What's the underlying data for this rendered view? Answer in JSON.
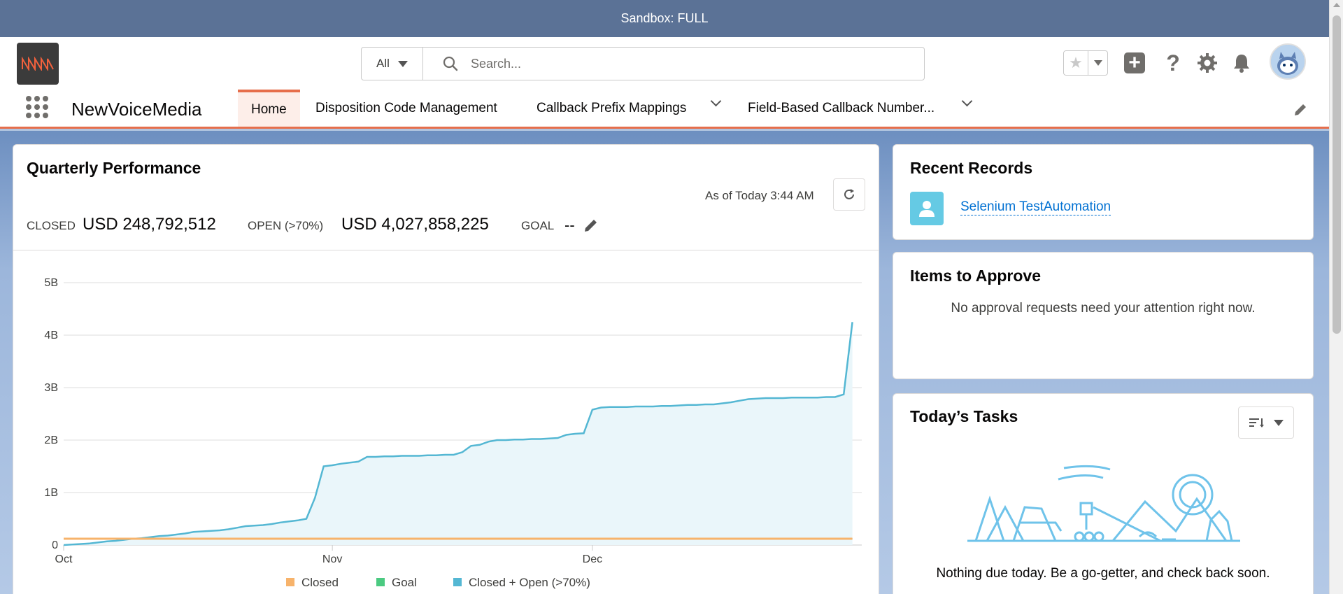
{
  "sandbox": {
    "label": "Sandbox: FULL"
  },
  "search": {
    "scope": "All",
    "placeholder": "Search..."
  },
  "nav": {
    "app_name": "NewVoiceMedia",
    "items": [
      {
        "label": "Home",
        "active": true
      },
      {
        "label": "Disposition Code Management"
      },
      {
        "label": "Callback Prefix Mappings"
      },
      {
        "label": "Field-Based Callback Number..."
      }
    ]
  },
  "performance": {
    "title": "Quarterly Performance",
    "as_of": "As of Today 3:44 AM",
    "closed_label": "CLOSED",
    "closed_value": "USD 248,792,512",
    "open_label": "OPEN (>70%)",
    "open_value": "USD 4,027,858,225",
    "goal_label": "GOAL",
    "goal_value": "--"
  },
  "chart_data": {
    "type": "line",
    "title": "",
    "xlabel": "",
    "ylabel": "",
    "y_ticks": [
      "0",
      "1B",
      "2B",
      "3B",
      "4B",
      "5B"
    ],
    "ylim": [
      0,
      5
    ],
    "x_ticks": [
      "Oct",
      "Nov",
      "Dec"
    ],
    "x_tick_days": [
      0,
      31,
      61
    ],
    "xlim": [
      0,
      92
    ],
    "legend": [
      "Closed",
      "Goal",
      "Closed + Open (>70%)"
    ],
    "colors": {
      "closed": "#f7b36b",
      "goal": "#4bca81",
      "closed_open": "#54b7d3"
    },
    "series": [
      {
        "name": "Closed + Open (>70%)",
        "x": [
          0,
          1,
          2,
          3,
          4,
          5,
          6,
          7,
          8,
          9,
          10,
          11,
          12,
          13,
          14,
          15,
          16,
          17,
          18,
          19,
          20,
          21,
          22,
          23,
          24,
          25,
          26,
          27,
          28,
          29,
          30,
          31,
          32,
          33,
          34,
          35,
          36,
          37,
          38,
          39,
          40,
          41,
          42,
          43,
          44,
          45,
          46,
          47,
          48,
          49,
          50,
          51,
          52,
          53,
          54,
          55,
          56,
          57,
          58,
          59,
          60,
          61,
          62,
          63,
          64,
          65,
          66,
          67,
          68,
          69,
          70,
          71,
          72,
          73,
          74,
          75,
          76,
          77,
          78,
          79,
          80,
          81,
          82,
          83,
          84,
          85,
          86,
          87,
          88,
          89,
          90,
          91
        ],
        "values": [
          0.0,
          0.01,
          0.02,
          0.03,
          0.05,
          0.07,
          0.08,
          0.1,
          0.12,
          0.13,
          0.15,
          0.17,
          0.18,
          0.2,
          0.22,
          0.25,
          0.26,
          0.27,
          0.28,
          0.3,
          0.33,
          0.36,
          0.37,
          0.38,
          0.4,
          0.43,
          0.45,
          0.47,
          0.5,
          0.9,
          1.5,
          1.52,
          1.55,
          1.57,
          1.59,
          1.68,
          1.68,
          1.69,
          1.69,
          1.7,
          1.7,
          1.7,
          1.71,
          1.71,
          1.72,
          1.72,
          1.77,
          1.89,
          1.91,
          1.97,
          2.0,
          2.0,
          2.01,
          2.01,
          2.02,
          2.02,
          2.03,
          2.04,
          2.1,
          2.12,
          2.13,
          2.58,
          2.62,
          2.63,
          2.63,
          2.63,
          2.64,
          2.64,
          2.64,
          2.65,
          2.65,
          2.66,
          2.67,
          2.67,
          2.68,
          2.68,
          2.7,
          2.72,
          2.75,
          2.78,
          2.79,
          2.8,
          2.8,
          2.8,
          2.81,
          2.81,
          2.81,
          2.81,
          2.82,
          2.82,
          2.87,
          4.25
        ]
      },
      {
        "name": "Closed",
        "x": [
          0,
          91
        ],
        "values": [
          0.12,
          0.12
        ]
      },
      {
        "name": "Goal",
        "x": [
          0,
          91
        ],
        "values": [
          0.12,
          0.12
        ]
      }
    ]
  },
  "recent_records": {
    "title": "Recent Records",
    "items": [
      {
        "label": "Selenium TestAutomation"
      }
    ]
  },
  "approve": {
    "title": "Items to Approve",
    "message": "No approval requests need your attention right now."
  },
  "tasks": {
    "title": "Today’s Tasks",
    "message": "Nothing due today. Be a go-getter, and check back soon."
  },
  "icons": {
    "search": "search-icon",
    "favorites": "star-icon",
    "add": "plus-icon",
    "help": "help-icon",
    "setup": "gear-icon",
    "notifications": "bell-icon",
    "refresh": "refresh-icon",
    "edit": "pencil-icon"
  }
}
